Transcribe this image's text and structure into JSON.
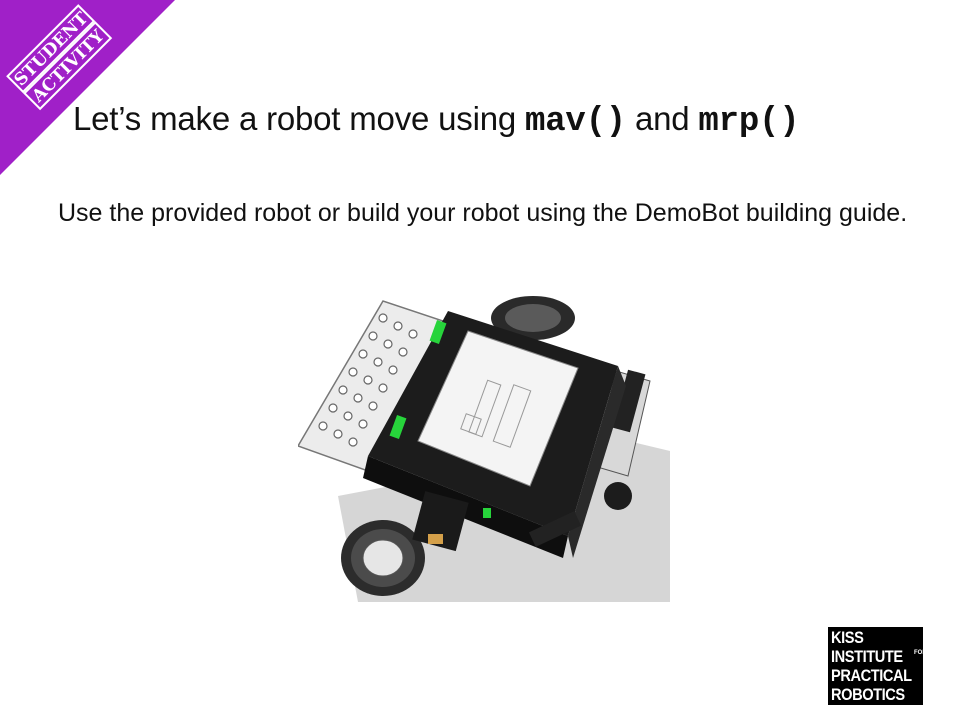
{
  "badge": {
    "line1": "STUDENT",
    "line2": "ACTIVITY",
    "color": "#a020c8"
  },
  "title": {
    "prefix": "Let’s make a robot move using ",
    "code1": "mav()",
    "middle": " and ",
    "code2": "mrp()"
  },
  "body": {
    "text": "Use the provided robot or build your robot using the DemoBot building guide."
  },
  "image": {
    "icon": "robot-illustration"
  },
  "logo": {
    "line1": "KISS",
    "line2": "INSTITUTE",
    "line2_sup": "FOR",
    "line3": "PRACTICAL",
    "line4": "ROBOTICS"
  }
}
